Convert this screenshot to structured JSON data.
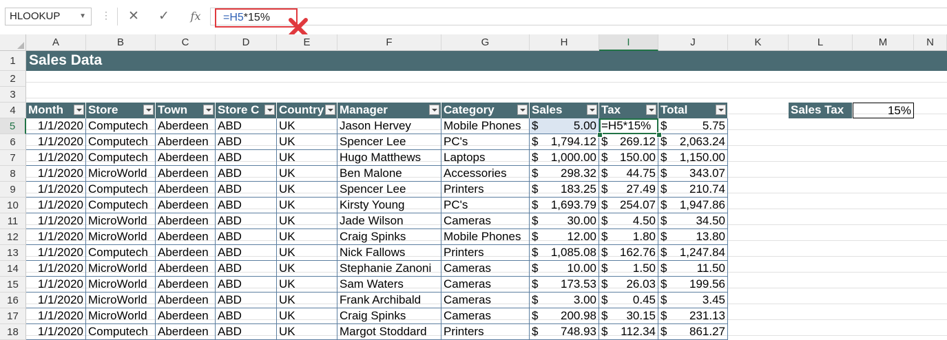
{
  "formula_bar": {
    "name_box": "HLOOKUP",
    "cancel_symbol": "✕",
    "enter_symbol": "✓",
    "fx_symbol": "fx",
    "formula_ref": "=H5",
    "formula_rest": "*15%"
  },
  "columns": [
    "A",
    "B",
    "C",
    "D",
    "E",
    "F",
    "G",
    "H",
    "I",
    "J",
    "K",
    "L",
    "M",
    "N"
  ],
  "rows": [
    "1",
    "2",
    "3",
    "4",
    "5",
    "6",
    "7",
    "8",
    "9",
    "10",
    "11",
    "12",
    "13",
    "14",
    "15",
    "16",
    "17",
    "18"
  ],
  "sheet": {
    "title": "Sales Data",
    "headers": [
      "Month",
      "Store",
      "Town",
      "Store C",
      "Country",
      "Manager",
      "Category",
      "Sales",
      "Tax",
      "Total"
    ],
    "records": [
      {
        "month": "1/1/2020",
        "store": "Computech",
        "town": "Aberdeen",
        "code": "ABD",
        "country": "UK",
        "manager": "Jason Hervey",
        "category": "Mobile Phones",
        "sales": "5.00",
        "tax": "=H5*15%",
        "total": "5.75"
      },
      {
        "month": "1/1/2020",
        "store": "Computech",
        "town": "Aberdeen",
        "code": "ABD",
        "country": "UK",
        "manager": "Spencer Lee",
        "category": "PC's",
        "sales": "1,794.12",
        "tax": "269.12",
        "total": "2,063.24"
      },
      {
        "month": "1/1/2020",
        "store": "Computech",
        "town": "Aberdeen",
        "code": "ABD",
        "country": "UK",
        "manager": "Hugo Matthews",
        "category": "Laptops",
        "sales": "1,000.00",
        "tax": "150.00",
        "total": "1,150.00"
      },
      {
        "month": "1/1/2020",
        "store": "MicroWorld",
        "town": "Aberdeen",
        "code": "ABD",
        "country": "UK",
        "manager": "Ben Malone",
        "category": "Accessories",
        "sales": "298.32",
        "tax": "44.75",
        "total": "343.07"
      },
      {
        "month": "1/1/2020",
        "store": "Computech",
        "town": "Aberdeen",
        "code": "ABD",
        "country": "UK",
        "manager": "Spencer Lee",
        "category": "Printers",
        "sales": "183.25",
        "tax": "27.49",
        "total": "210.74"
      },
      {
        "month": "1/1/2020",
        "store": "Computech",
        "town": "Aberdeen",
        "code": "ABD",
        "country": "UK",
        "manager": "Kirsty Young",
        "category": "PC's",
        "sales": "1,693.79",
        "tax": "254.07",
        "total": "1,947.86"
      },
      {
        "month": "1/1/2020",
        "store": "MicroWorld",
        "town": "Aberdeen",
        "code": "ABD",
        "country": "UK",
        "manager": "Jade Wilson",
        "category": "Cameras",
        "sales": "30.00",
        "tax": "4.50",
        "total": "34.50"
      },
      {
        "month": "1/1/2020",
        "store": "MicroWorld",
        "town": "Aberdeen",
        "code": "ABD",
        "country": "UK",
        "manager": "Craig Spinks",
        "category": "Mobile Phones",
        "sales": "12.00",
        "tax": "1.80",
        "total": "13.80"
      },
      {
        "month": "1/1/2020",
        "store": "Computech",
        "town": "Aberdeen",
        "code": "ABD",
        "country": "UK",
        "manager": "Nick Fallows",
        "category": "Printers",
        "sales": "1,085.08",
        "tax": "162.76",
        "total": "1,247.84"
      },
      {
        "month": "1/1/2020",
        "store": "MicroWorld",
        "town": "Aberdeen",
        "code": "ABD",
        "country": "UK",
        "manager": "Stephanie Zanoni",
        "category": "Cameras",
        "sales": "10.00",
        "tax": "1.50",
        "total": "11.50"
      },
      {
        "month": "1/1/2020",
        "store": "MicroWorld",
        "town": "Aberdeen",
        "code": "ABD",
        "country": "UK",
        "manager": "Sam Waters",
        "category": "Cameras",
        "sales": "173.53",
        "tax": "26.03",
        "total": "199.56"
      },
      {
        "month": "1/1/2020",
        "store": "MicroWorld",
        "town": "Aberdeen",
        "code": "ABD",
        "country": "UK",
        "manager": "Frank Archibald",
        "category": "Cameras",
        "sales": "3.00",
        "tax": "0.45",
        "total": "3.45"
      },
      {
        "month": "1/1/2020",
        "store": "MicroWorld",
        "town": "Aberdeen",
        "code": "ABD",
        "country": "UK",
        "manager": "Craig Spinks",
        "category": "Cameras",
        "sales": "200.98",
        "tax": "30.15",
        "total": "231.13"
      },
      {
        "month": "1/1/2020",
        "store": "Computech",
        "town": "Aberdeen",
        "code": "ABD",
        "country": "UK",
        "manager": "Margot Stoddard",
        "category": "Printers",
        "sales": "748.93",
        "tax": "112.34",
        "total": "861.27"
      }
    ],
    "currency_symbol": "$",
    "sales_tax_label": "Sales Tax",
    "sales_tax_value": "15%"
  },
  "colors": {
    "header_band": "#4a6b73",
    "excel_green": "#217346",
    "cancel_red": "#e0393e"
  }
}
